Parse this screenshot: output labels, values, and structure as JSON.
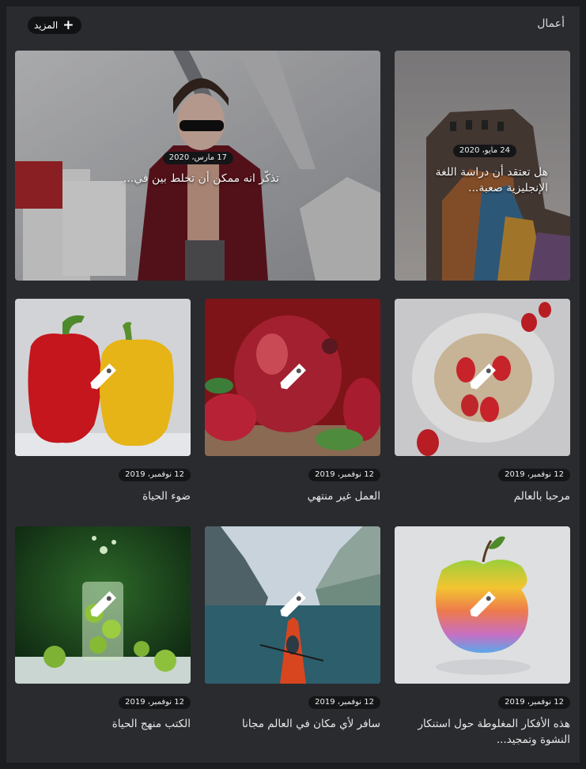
{
  "header": {
    "title": "أعمال",
    "more_label": "المزيد",
    "more_icon": "plus-icon"
  },
  "featured": [
    {
      "date": "24 مايو، 2020",
      "title": "هل تعتقد أن دراسة اللغة الإنجليزية صعبة...",
      "image": "graffiti-building-photo"
    },
    {
      "date": "17 مارس، 2020",
      "title": "تذكّر انه ممكن أن تخلط بين في...",
      "image": "woman-with-shopping-bags-photo"
    }
  ],
  "grid": [
    {
      "date": "12 نوفمبر، 2019",
      "title": "مرحبا بالعالم",
      "image": "oatmeal-strawberries-photo",
      "icon": "tag-icon"
    },
    {
      "date": "12 نوفمبر، 2019",
      "title": "العمل غير منتهي",
      "image": "pomegranate-photo",
      "icon": "tag-icon"
    },
    {
      "date": "12 نوفمبر، 2019",
      "title": "ضوء الحياة",
      "image": "bell-peppers-photo",
      "icon": "tag-icon"
    },
    {
      "date": "12 نوفمبر، 2019",
      "title": "هذه الأفكار المغلوطة حول استنكار النشوة وتمجيد...",
      "image": "rainbow-apple-photo",
      "icon": "tag-icon"
    },
    {
      "date": "12 نوفمبر، 2019",
      "title": "سافر لأي مكان في العالم مجانا",
      "image": "kayak-fjord-photo",
      "icon": "tag-icon"
    },
    {
      "date": "12 نوفمبر، 2019",
      "title": "الكتب منهج الحياة",
      "image": "lime-splash-glass-photo",
      "icon": "tag-icon"
    }
  ]
}
